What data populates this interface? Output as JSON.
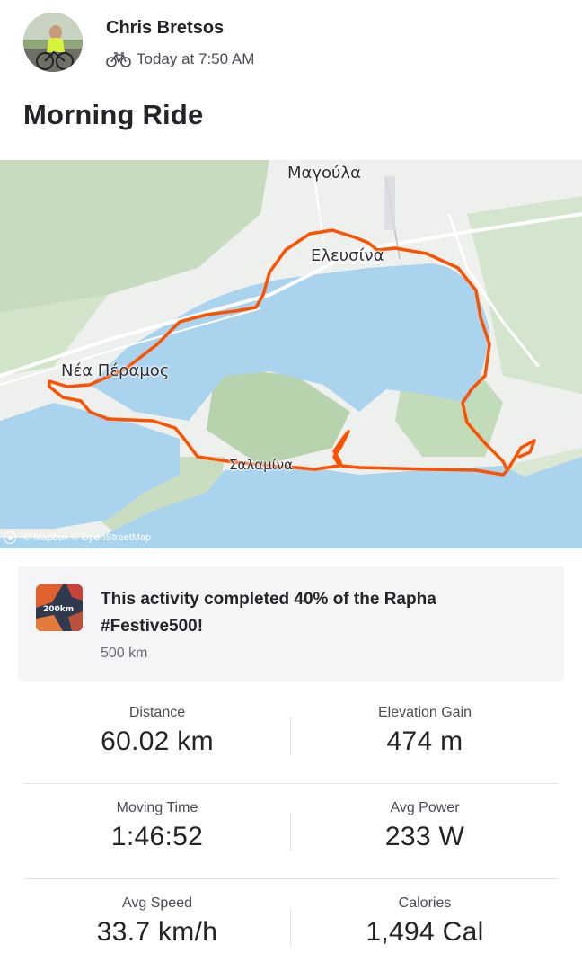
{
  "athlete": {
    "name": "Chris Bretsos",
    "timestamp": "Today at 7:50 AM",
    "activity_icon": "bike-icon"
  },
  "activity": {
    "title": "Morning Ride"
  },
  "map": {
    "labels": {
      "magoula": "Μαγούλα",
      "elefsina": "Ελευσίνα",
      "nea_peramos": "Νέα Πέραμος",
      "salamina": "Σαλαμίνα"
    },
    "attribution": "© Mapbox © OpenStreetMap",
    "route_color": "#fc5200",
    "water_color": "#aad3ee",
    "land_color": "#eef0ee",
    "green_color": "#b9d6ae"
  },
  "challenge": {
    "badge_text": "200km",
    "text": "This activity completed 40% of the Rapha #Festive500!",
    "goal": "500 km",
    "progress_percent": 40
  },
  "stats": [
    {
      "left": {
        "label": "Distance",
        "value": "60.02 km"
      },
      "right": {
        "label": "Elevation Gain",
        "value": "474 m"
      }
    },
    {
      "left": {
        "label": "Moving Time",
        "value": "1:46:52"
      },
      "right": {
        "label": "Avg Power",
        "value": "233 W"
      }
    },
    {
      "left": {
        "label": "Avg Speed",
        "value": "33.7 km/h"
      },
      "right": {
        "label": "Calories",
        "value": "1,494 Cal"
      }
    }
  ]
}
